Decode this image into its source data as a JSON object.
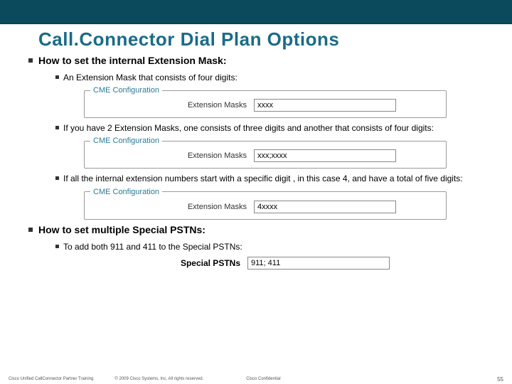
{
  "title": "Call.Connector Dial Plan Options",
  "section1": {
    "heading": "How to set the internal Extension Mask:",
    "items": [
      {
        "text": "An Extension Mask that consists of four digits:",
        "legend": "CME Configuration",
        "label": "Extension Masks",
        "value": "xxxx"
      },
      {
        "text": "If you have 2 Extension Masks, one consists of three digits and another that consists of four digits:",
        "legend": "CME Configuration",
        "label": "Extension Masks",
        "value": "xxx;xxxx"
      },
      {
        "text": "If all the internal extension numbers start with a specific digit , in this case 4, and have a total of five digits:",
        "legend": "CME Configuration",
        "label": "Extension Masks",
        "value": "4xxxx"
      }
    ]
  },
  "section2": {
    "heading": "How to set multiple Special PSTNs:",
    "item_text": "To add both 911 and 411 to the Special PSTNs:",
    "label": "Special PSTNs",
    "value": "911; 411"
  },
  "footer": {
    "left": "Cisco Unified CallConnector Partner Training",
    "center": "© 2009 Cisco Systems, Inc. All rights reserved.",
    "right": "Cisco Confidential",
    "page": "55"
  }
}
